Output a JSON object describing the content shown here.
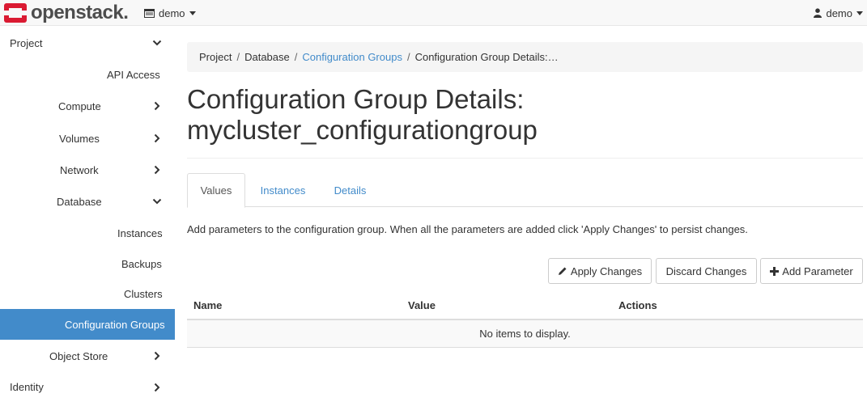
{
  "brand": {
    "name": "openstack."
  },
  "header": {
    "project_label": "demo",
    "user_label": "demo"
  },
  "sidebar": {
    "items": [
      {
        "label": "Project",
        "icon": "chevron-down-icon"
      },
      {
        "label": "API Access"
      },
      {
        "label": "Compute",
        "icon": "chevron-right-icon"
      },
      {
        "label": "Volumes",
        "icon": "chevron-right-icon"
      },
      {
        "label": "Network",
        "icon": "chevron-right-icon"
      },
      {
        "label": "Database",
        "icon": "chevron-down-icon"
      },
      {
        "label": "Instances"
      },
      {
        "label": "Backups"
      },
      {
        "label": "Clusters"
      },
      {
        "label": "Configuration Groups",
        "active": true
      },
      {
        "label": "Object Store",
        "icon": "chevron-right-icon"
      },
      {
        "label": "Identity",
        "icon": "chevron-right-icon"
      }
    ]
  },
  "breadcrumb": {
    "items": [
      "Project",
      "Database",
      "Configuration Groups",
      "Configuration Group Details:…"
    ],
    "separator": "/"
  },
  "page": {
    "title_line1": "Configuration Group Details:",
    "title_line2": "mycluster_configurationgroup"
  },
  "tabs": [
    {
      "label": "Values",
      "active": true
    },
    {
      "label": "Instances"
    },
    {
      "label": "Details"
    }
  ],
  "help_text": "Add parameters to the configuration group. When all the parameters are added click 'Apply Changes' to persist changes.",
  "actions": {
    "apply_label": "Apply Changes",
    "discard_label": "Discard Changes",
    "add_label": "Add Parameter"
  },
  "table": {
    "columns": [
      "Name",
      "Value",
      "Actions"
    ],
    "empty_text": "No items to display."
  },
  "colors": {
    "accent": "#428bca",
    "brand_red": "#da1a32",
    "active_bg": "#428bca"
  }
}
